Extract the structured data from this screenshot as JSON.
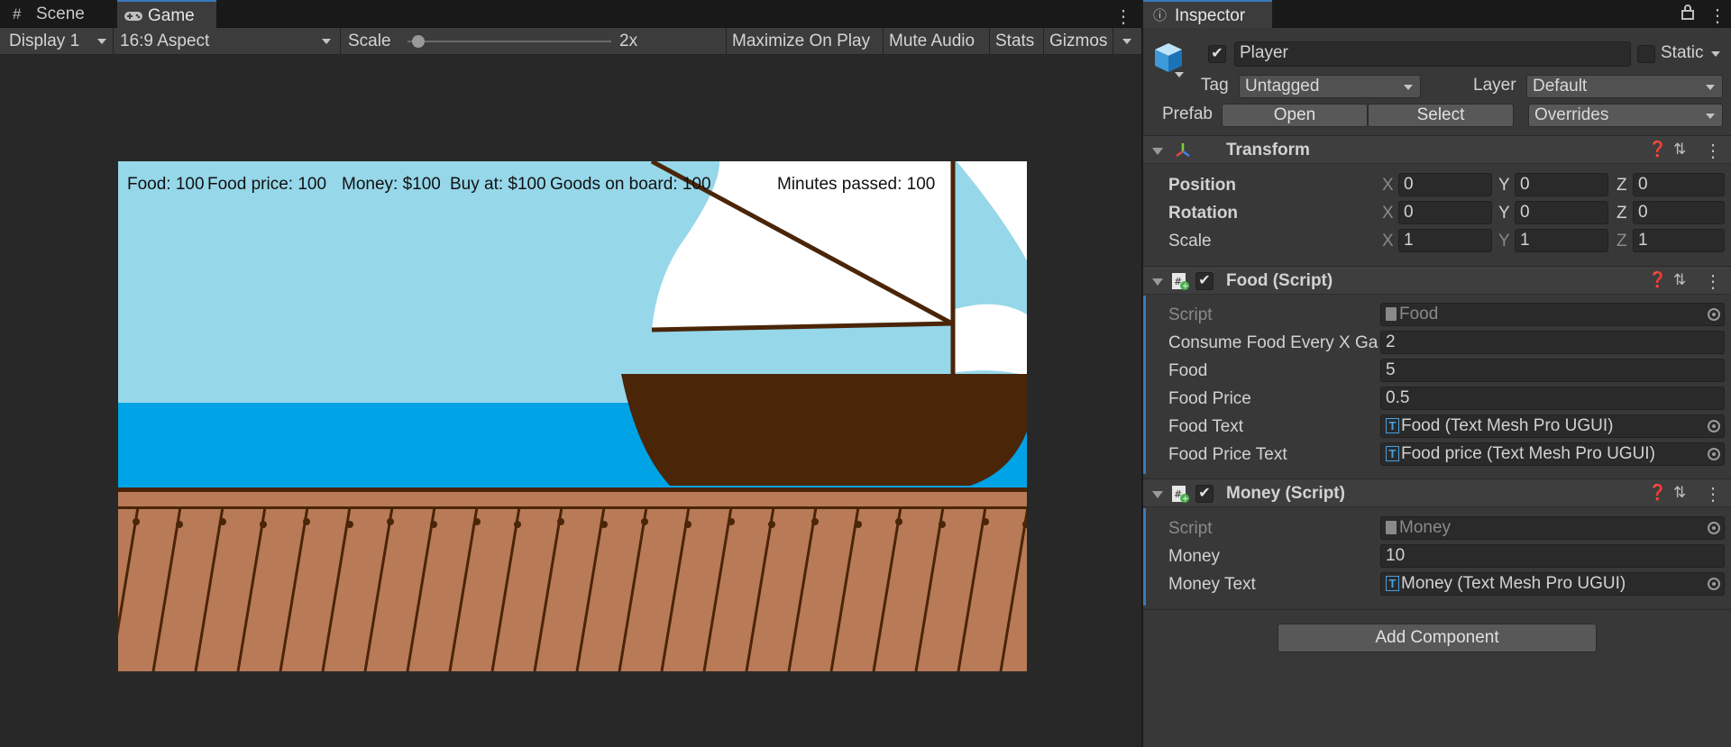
{
  "tabs": {
    "scene": "Scene",
    "game": "Game",
    "inspector": "Inspector"
  },
  "toolbar": {
    "display": "Display 1",
    "aspect": "16:9 Aspect",
    "scale_label": "Scale",
    "scale_value": "2x",
    "scale_fraction": 0.05,
    "maximize": "Maximize On Play",
    "mute": "Mute Audio",
    "stats": "Stats",
    "gizmos": "Gizmos"
  },
  "hud": {
    "food": "Food: 100",
    "food_price": "Food price: 100",
    "money": "Money: $100",
    "buy_at": "Buy at: $100",
    "goods": "Goods on board: 100",
    "minutes": "Minutes passed: 100"
  },
  "inspector": {
    "object_name": "Player",
    "object_active": true,
    "static_label": "Static",
    "tag_label": "Tag",
    "tag_value": "Untagged",
    "layer_label": "Layer",
    "layer_value": "Default",
    "prefab_label": "Prefab",
    "open": "Open",
    "select": "Select",
    "overrides": "Overrides",
    "transform": {
      "title": "Transform",
      "position_label": "Position",
      "rotation_label": "Rotation",
      "scale_label": "Scale",
      "position": {
        "x": "0",
        "y": "0",
        "z": "0"
      },
      "rotation": {
        "x": "0",
        "y": "0",
        "z": "0"
      },
      "scale": {
        "x": "1",
        "y": "1",
        "z": "1"
      }
    },
    "food_script": {
      "title": "Food (Script)",
      "script_label": "Script",
      "script_value": "Food",
      "consume_label": "Consume Food Every X Ga",
      "consume_value": "2",
      "food_label": "Food",
      "food_value": "5",
      "price_label": "Food Price",
      "price_value": "0.5",
      "food_text_label": "Food Text",
      "food_text_value": "Food (Text Mesh Pro UGUI)",
      "price_text_label": "Food Price Text",
      "price_text_value": "Food price (Text Mesh Pro UGUI)"
    },
    "money_script": {
      "title": "Money (Script)",
      "script_label": "Script",
      "script_value": "Money",
      "money_label": "Money",
      "money_value": "10",
      "money_text_label": "Money Text",
      "money_text_value": "Money (Text Mesh Pro UGUI)"
    },
    "add_component": "Add Component"
  },
  "axis": {
    "x": "X",
    "y": "Y",
    "z": "Z"
  },
  "colors": {
    "sky": "#96d7ea",
    "sea": "#00a3e6",
    "hull": "#4a2508",
    "dock": "#b97a57",
    "accent": "#3a79bb"
  }
}
